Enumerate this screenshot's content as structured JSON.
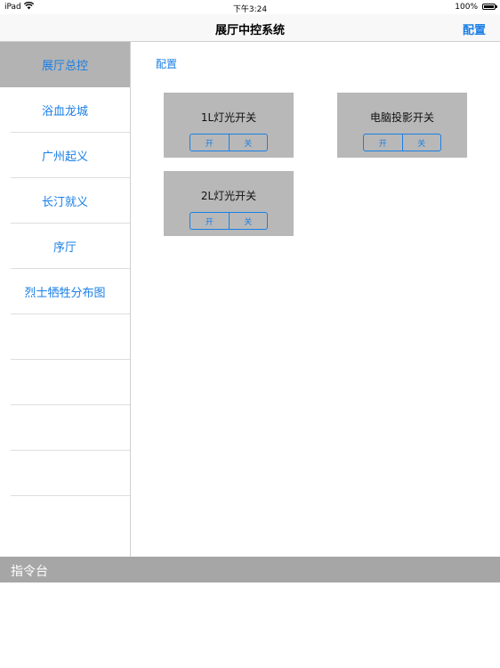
{
  "status_bar": {
    "device": "iPad",
    "time": "下午3:24",
    "battery": "100%",
    "icons": [
      "wifi-icon",
      "battery-icon"
    ]
  },
  "navbar": {
    "title": "展厅中控系统",
    "config_button": "配置"
  },
  "sidebar": {
    "items": [
      {
        "label": "展厅总控",
        "selected": true
      },
      {
        "label": "浴血龙城",
        "selected": false
      },
      {
        "label": "广州起义",
        "selected": false
      },
      {
        "label": "长汀就义",
        "selected": false
      },
      {
        "label": "序厅",
        "selected": false
      },
      {
        "label": "烈士牺牲分布图",
        "selected": false
      },
      {
        "label": "",
        "selected": false
      },
      {
        "label": "",
        "selected": false
      },
      {
        "label": "",
        "selected": false
      },
      {
        "label": "",
        "selected": false
      }
    ]
  },
  "main": {
    "config_link": "配置",
    "cards": [
      {
        "name": "1L灯光开关",
        "on_label": "开",
        "off_label": "关"
      },
      {
        "name": "电脑投影开关",
        "on_label": "开",
        "off_label": "关"
      },
      {
        "name": "2L灯光开关",
        "on_label": "开",
        "off_label": "关"
      }
    ]
  },
  "console": {
    "label": "指令台"
  },
  "colors": {
    "accent": "#1a7fe6",
    "card_bg": "#b8b8b8",
    "selected_bg": "#b3b3b3",
    "console_bar_bg": "#a6a6a6"
  }
}
